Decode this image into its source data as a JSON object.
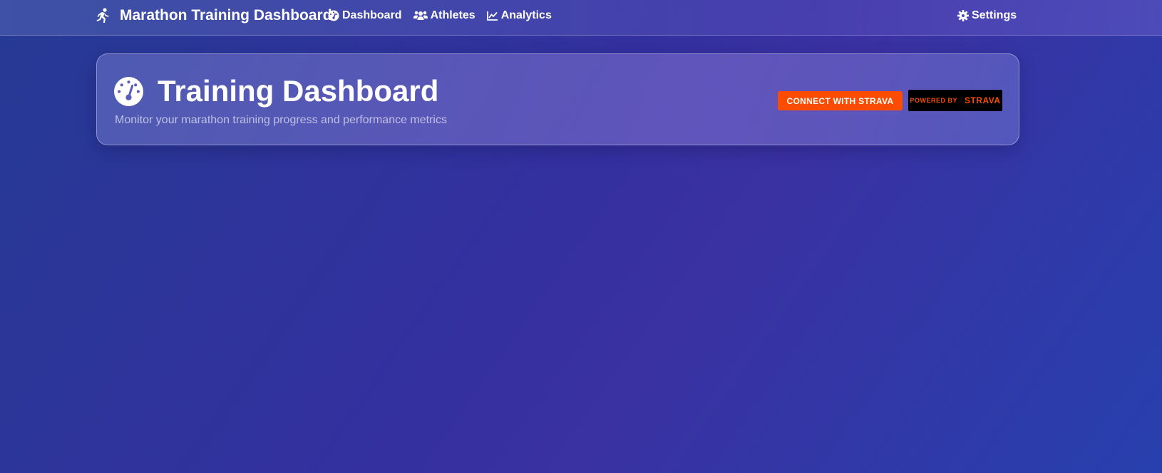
{
  "navbar": {
    "brand_title": "Marathon Training Dashboard",
    "brand_icon": "running-icon",
    "links": [
      {
        "label": "Dashboard",
        "icon": "tachometer-icon"
      },
      {
        "label": "Athletes",
        "icon": "users-icon"
      },
      {
        "label": "Analytics",
        "icon": "chart-line-icon"
      }
    ],
    "settings": {
      "label": "Settings",
      "icon": "gear-icon"
    }
  },
  "header": {
    "title": "Training Dashboard",
    "title_icon": "gauge-icon",
    "subtitle": "Monitor your marathon training progress and performance metrics",
    "connect_button": "CONNECT WITH STRAVA",
    "powered_by": "POWERED BY",
    "powered_brand": "STRAVA"
  },
  "colors": {
    "strava_orange": "#fc4c02",
    "background_start": "#263a94",
    "background_mid": "#3a31a2",
    "background_end": "#2740ad"
  }
}
